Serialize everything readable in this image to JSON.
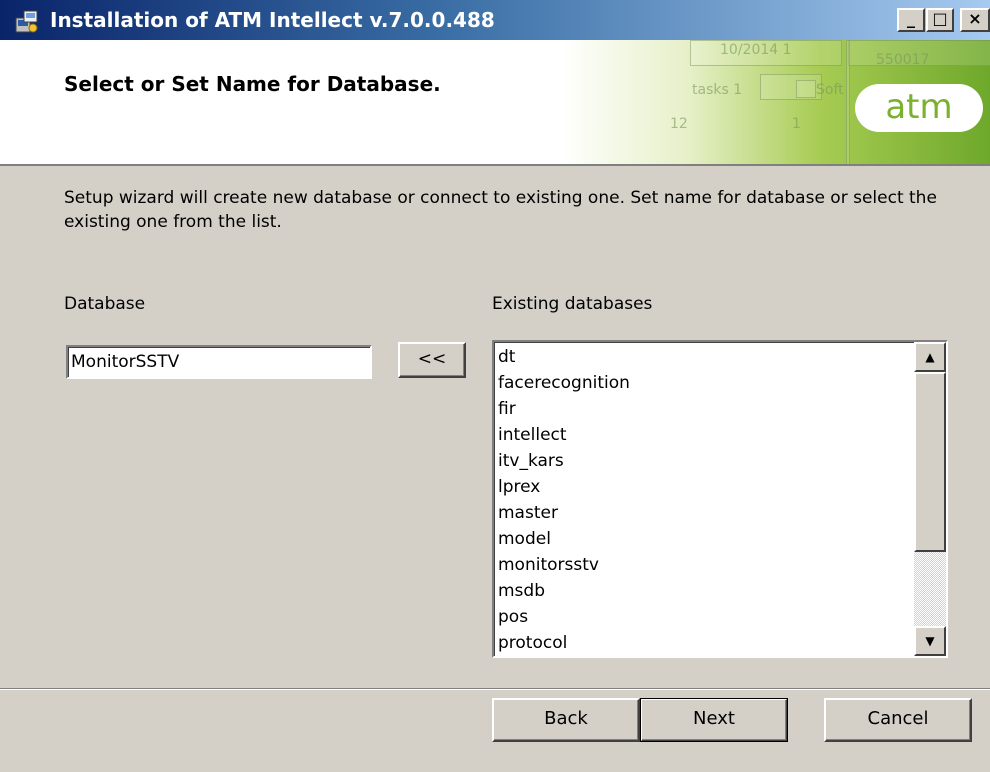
{
  "window": {
    "title": "Installation of ATM Intellect v.7.0.0.488",
    "controls": {
      "minimize": "_",
      "maximize": "□",
      "close": "×"
    }
  },
  "header": {
    "title": "Select or Set Name for Database.",
    "logo_text": "atm",
    "background_fragments": [
      "10/2014 1",
      "550017",
      "Soft",
      "tasks 1",
      "12",
      "1"
    ]
  },
  "description": "Setup wizard will create new database or connect to existing one. Set name for database or select the existing one from the list.",
  "database": {
    "label": "Database",
    "value": "MonitorSSTV"
  },
  "move_button": {
    "label": "<<"
  },
  "existing": {
    "label": "Existing databases",
    "items": [
      "dt",
      "facerecognition",
      "fir",
      "intellect",
      "itv_kars",
      "lprex",
      "master",
      "model",
      "monitorsstv",
      "msdb",
      "pos",
      "protocol"
    ]
  },
  "footer": {
    "back_label": "Back",
    "next_label": "Next",
    "cancel_label": "Cancel"
  },
  "colors": {
    "title_bar": "#0a246a",
    "dialog_bg": "#d4d0c8",
    "logo_green": "#7ab12e"
  },
  "icons": {
    "title_icon": "installer-icon",
    "scroll_up": "arrow-up-icon",
    "scroll_down": "arrow-down-icon"
  }
}
